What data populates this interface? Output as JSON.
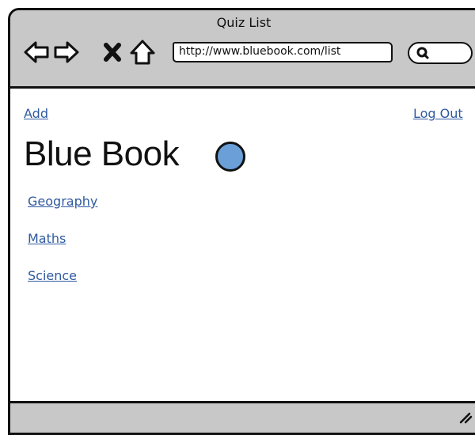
{
  "window": {
    "title": "Quiz List"
  },
  "toolbar": {
    "back_icon": "arrow-left-icon",
    "forward_icon": "arrow-right-icon",
    "stop_icon": "close-icon",
    "home_icon": "home-icon",
    "url": "http://www.bluebook.com/list",
    "search_icon": "search-icon"
  },
  "page": {
    "add_label": "Add",
    "logout_label": "Log Out",
    "brand_title": "Blue Book",
    "quizzes": [
      {
        "label": "Geography"
      },
      {
        "label": "Maths"
      },
      {
        "label": "Science"
      }
    ]
  },
  "colors": {
    "chrome": "#c8c8c8",
    "link": "#2f5aa0",
    "brand_dot": "#6a9fd8"
  }
}
